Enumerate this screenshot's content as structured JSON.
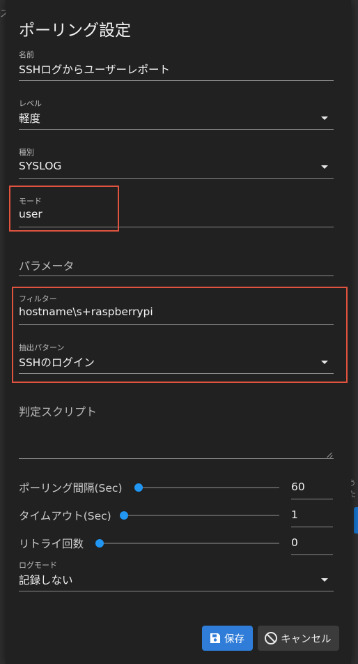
{
  "background": {
    "top_left_glyph": "ス",
    "right_glyph": "うた"
  },
  "dialog": {
    "title": "ポーリング設定",
    "fields": {
      "name": {
        "label": "名前",
        "value": "SSHログからユーザーレポート"
      },
      "level": {
        "label": "レベル",
        "value": "軽度"
      },
      "type": {
        "label": "種別",
        "value": "SYSLOG"
      },
      "mode": {
        "label": "モード",
        "value": "user"
      },
      "params": {
        "placeholder": "パラメータ"
      },
      "filter": {
        "label": "フィルター",
        "value": "hostname\\s+raspberrypi"
      },
      "extract": {
        "label": "抽出パターン",
        "value": "SSHのログイン"
      },
      "script": {
        "placeholder": "判定スクリプト"
      },
      "log_mode": {
        "label": "ログモード",
        "value": "記録しない"
      }
    },
    "sliders": [
      {
        "label": "ポーリング間隔(Sec)",
        "value": "60"
      },
      {
        "label": "タイムアウト(Sec)",
        "value": "1"
      },
      {
        "label": "リトライ回数",
        "value": "0"
      }
    ],
    "buttons": {
      "save": "保存",
      "cancel": "キャンセル"
    }
  },
  "colors": {
    "accent": "#2196f3",
    "save_button": "#2f7dd8",
    "highlight_box": "#e0533f",
    "dialog_bg": "#212121"
  },
  "icons": {
    "save": "floppy-disk-icon",
    "cancel": "cancel-circle-icon",
    "dropdown": "caret-down-icon"
  }
}
